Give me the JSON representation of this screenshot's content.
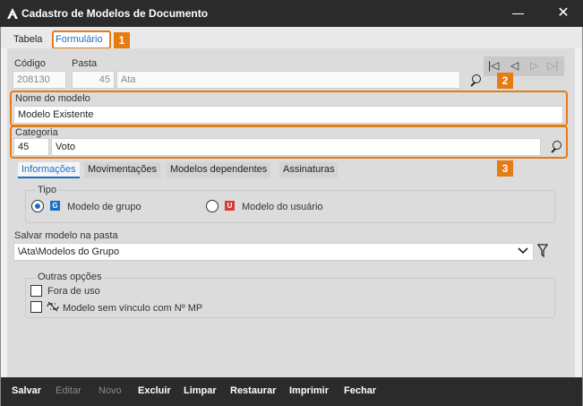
{
  "window": {
    "title": "Cadastro de Modelos de Documento"
  },
  "tabs": {
    "tabela": "Tabela",
    "formulario": "Formulário"
  },
  "badges": [
    "1",
    "2",
    "3"
  ],
  "fields": {
    "codigo_label": "Código",
    "codigo_value": "208130",
    "pasta_label": "Pasta",
    "pasta_num": "45",
    "pasta_name": "Ata",
    "nome_label": "Nome do modelo",
    "nome_value": "Modelo Existente",
    "categoria_label": "Categoria",
    "categoria_num": "45",
    "categoria_name": "Voto"
  },
  "subtabs": [
    "Informações",
    "Movimentações",
    "Modelos dependentes",
    "Assinaturas"
  ],
  "tipo": {
    "label": "Tipo",
    "grupo_label": "Modelo de grupo",
    "grupo_badge": "G",
    "usuario_label": "Modelo do usuário",
    "usuario_badge": "U",
    "selected": "grupo"
  },
  "salvar": {
    "label": "Salvar modelo na pasta",
    "value": "\\Ata\\Modelos do Grupo"
  },
  "outras": {
    "label": "Outras opções",
    "fora_de_uso": "Fora de uso",
    "sem_vinculo": "Modelo sem vínculo com Nº MP"
  },
  "bottom": {
    "salvar": "Salvar",
    "editar": "Editar",
    "novo": "Novo",
    "excluir": "Excluir",
    "limpar": "Limpar",
    "restaurar": "Restaurar",
    "imprimir": "Imprimir",
    "fechar": "Fechar"
  },
  "colors": {
    "accent": "#1a6fc4",
    "highlight": "#e57c12"
  }
}
